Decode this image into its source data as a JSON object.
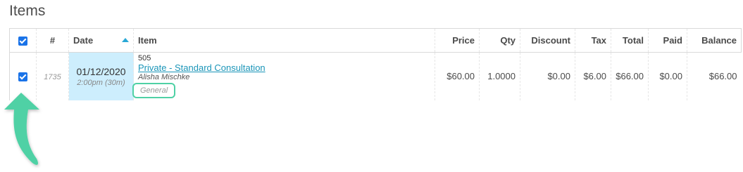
{
  "section_title": "Items",
  "table": {
    "headers": {
      "hash": "#",
      "date": "Date",
      "item": "Item",
      "price": "Price",
      "qty": "Qty",
      "discount": "Discount",
      "tax": "Tax",
      "total": "Total",
      "paid": "Paid",
      "balance": "Balance"
    },
    "rows": [
      {
        "checked": true,
        "number": "1735",
        "date": "01/12/2020",
        "time": "2:00pm (30m)",
        "item_code": "505",
        "item_name": "Private - Standard Consultation",
        "provider": "Alisha Mischke",
        "category": "General",
        "price": "$60.00",
        "qty": "1.0000",
        "discount": "$0.00",
        "tax": "$6.00",
        "total": "$66.00",
        "paid": "$0.00",
        "balance": "$66.00"
      }
    ]
  },
  "colors": {
    "accent": "#1a73e8",
    "highlight_arrow": "#4fd1a5",
    "balance_due": "#d9534f",
    "date_highlight": "#cdeefd"
  }
}
